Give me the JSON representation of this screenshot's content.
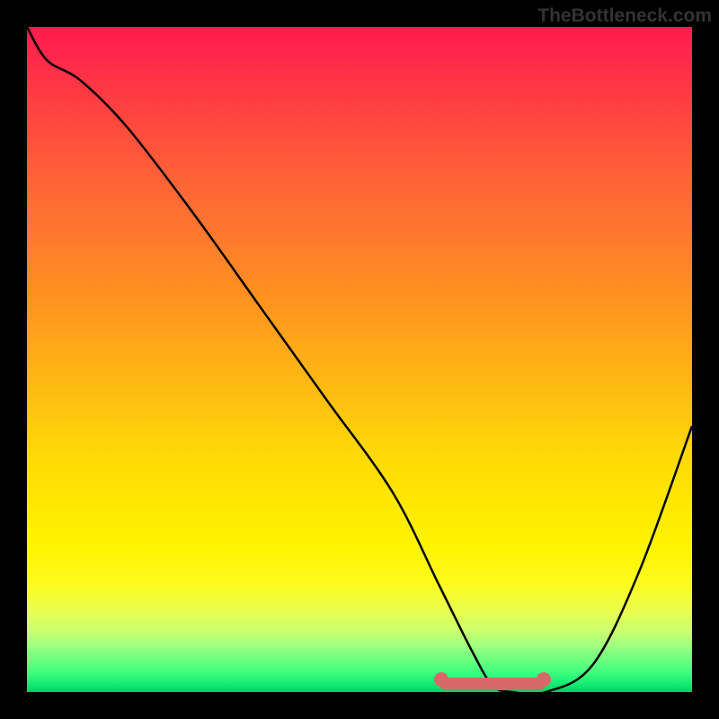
{
  "watermark": "TheBottleneck.com",
  "chart_data": {
    "type": "line",
    "title": "",
    "xlabel": "",
    "ylabel": "",
    "xlim": [
      0,
      100
    ],
    "ylim": [
      0,
      100
    ],
    "x": [
      0,
      3,
      8,
      15,
      25,
      35,
      45,
      55,
      62,
      67,
      70,
      73,
      78,
      85,
      92,
      100
    ],
    "values": [
      100,
      95,
      92,
      85,
      72,
      58,
      44,
      30,
      16,
      6,
      1,
      0,
      0,
      4,
      18,
      40
    ],
    "highlight_band_x": [
      62,
      78
    ],
    "background": "vertical gradient red→orange→yellow→green",
    "series_color": "#000000",
    "highlight_color": "#d86868"
  }
}
